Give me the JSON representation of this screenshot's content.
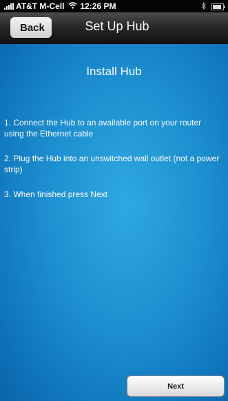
{
  "status_bar": {
    "carrier": "AT&T M-Cell",
    "time": "12:26 PM",
    "battery_level": 0.85
  },
  "nav_bar": {
    "back_label": "Back",
    "title": "Set Up Hub"
  },
  "main": {
    "heading": "Install Hub",
    "steps": [
      "1. Connect the Hub to an available port on your router using the Ethernet cable",
      "2. Plug the Hub into an unswitched wall outlet (not a power strip)",
      "3. When finished press Next"
    ],
    "next_label": "Next"
  },
  "colors": {
    "background_accent": "#1d8fd0",
    "nav_bar": "#262626"
  },
  "icons": [
    "signal-icon",
    "wifi-icon",
    "bluetooth-icon",
    "battery-icon"
  ]
}
